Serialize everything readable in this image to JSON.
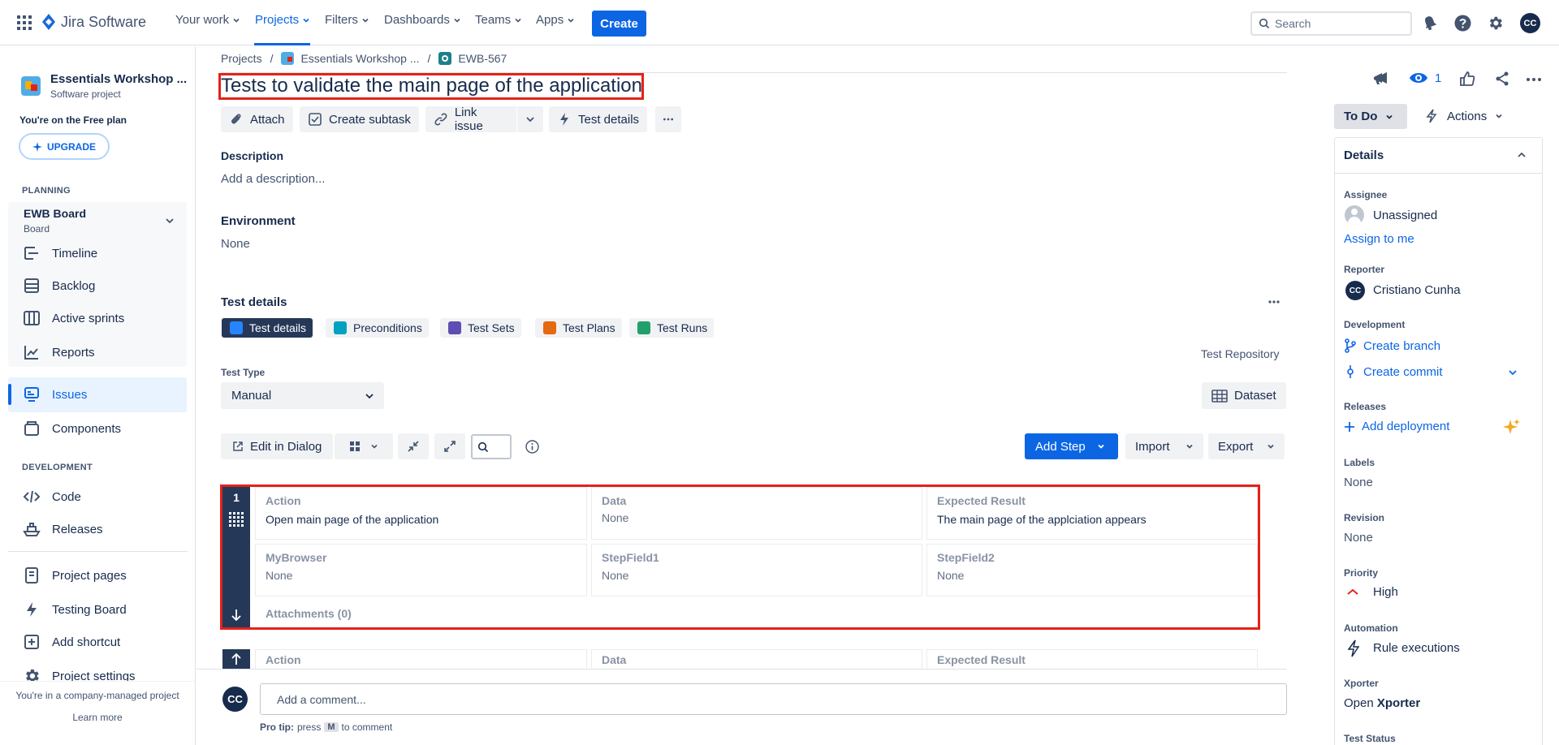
{
  "topnav": {
    "logo_text": "Jira Software",
    "items": [
      {
        "label": "Your work"
      },
      {
        "label": "Projects"
      },
      {
        "label": "Filters"
      },
      {
        "label": "Dashboards"
      },
      {
        "label": "Teams"
      },
      {
        "label": "Apps"
      }
    ],
    "create_label": "Create",
    "search_placeholder": "Search",
    "avatar_initials": "CC"
  },
  "sidebar": {
    "project_name": "Essentials Workshop ...",
    "project_type": "Software project",
    "plan_text": "You're on the Free plan",
    "upgrade_label": "UPGRADE",
    "planning_header": "PLANNING",
    "board_name": "EWB Board",
    "board_sub": "Board",
    "planning_items": [
      "Timeline",
      "Backlog",
      "Active sprints",
      "Reports"
    ],
    "issues_label": "Issues",
    "components_label": "Components",
    "development_header": "DEVELOPMENT",
    "dev_items": [
      "Code",
      "Releases"
    ],
    "bottom_items": [
      "Project pages",
      "Testing Board",
      "Add shortcut",
      "Project settings"
    ],
    "company_text": "You're in a company-managed project",
    "learn_more": "Learn more"
  },
  "breadcrumb": {
    "projects": "Projects",
    "project": "Essentials Workshop ...",
    "issue": "EWB-567"
  },
  "issue": {
    "title": "Tests to validate the main page of the application",
    "toolbar": {
      "attach": "Attach",
      "create_subtask": "Create subtask",
      "link_issue": "Link issue",
      "test_details": "Test details"
    },
    "description_label": "Description",
    "description_placeholder": "Add a description...",
    "environment_label": "Environment",
    "environment_value": "None"
  },
  "test_details": {
    "header": "Test details",
    "tabs": [
      "Test details",
      "Preconditions",
      "Test Sets",
      "Test Plans",
      "Test Runs"
    ],
    "repository_label": "Test Repository",
    "test_type_label": "Test Type",
    "test_type_value": "Manual",
    "dataset_label": "Dataset",
    "edit_dialog_label": "Edit in Dialog",
    "add_step_label": "Add Step",
    "import_label": "Import",
    "export_label": "Export",
    "steps": [
      {
        "number": "1",
        "action_h": "Action",
        "action": "Open main page of the application",
        "data_h": "Data",
        "data": "None",
        "expected_h": "Expected Result",
        "expected": "The main page of the applciation appears",
        "f1_h": "MyBrowser",
        "f1": "None",
        "f2_h": "StepField1",
        "f2": "None",
        "f3_h": "StepField2",
        "f3": "None",
        "attachments": "Attachments (0)"
      }
    ],
    "next_step_headers": [
      "Action",
      "Data",
      "Expected Result"
    ]
  },
  "comment": {
    "avatar": "CC",
    "placeholder": "Add a comment...",
    "pro_tip_bold": "Pro tip:",
    "pro_tip_press": "press",
    "pro_tip_key": "M",
    "pro_tip_rest": "to comment"
  },
  "right_panel": {
    "watch_count": "1",
    "status": "To Do",
    "actions": "Actions",
    "details_header": "Details",
    "assignee_label": "Assignee",
    "assignee_value": "Unassigned",
    "assign_to_me": "Assign to me",
    "reporter_label": "Reporter",
    "reporter_value": "Cristiano Cunha",
    "reporter_initials": "CC",
    "development_label": "Development",
    "create_branch": "Create branch",
    "create_commit": "Create commit",
    "releases_label": "Releases",
    "add_deployment": "Add deployment",
    "labels_label": "Labels",
    "labels_value": "None",
    "revision_label": "Revision",
    "revision_value": "None",
    "priority_label": "Priority",
    "priority_value": "High",
    "automation_label": "Automation",
    "automation_value": "Rule executions",
    "xporter_label": "Xporter",
    "xporter_open": "Open",
    "xporter_name": "Xporter",
    "test_status_label": "Test Status"
  }
}
